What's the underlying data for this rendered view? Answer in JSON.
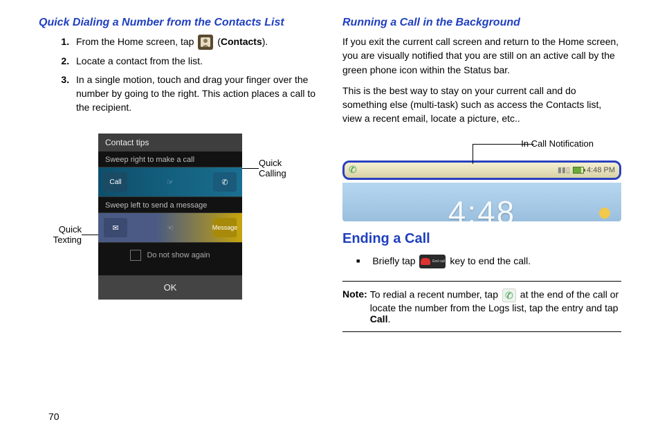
{
  "page_number": "70",
  "left": {
    "heading": "Quick Dialing a Number from the Contacts List",
    "steps": {
      "s1_a": "From the Home screen, tap ",
      "s1_b": " (",
      "s1_bold": "Contacts",
      "s1_c": ").",
      "s2": "Locate a contact from the list.",
      "s3": "In a single motion, touch and drag your finger over the number by going to the right. This action places a call to the recipient."
    },
    "fig": {
      "title": "Contact tips",
      "hint_call": "Sweep right to make a call",
      "row_call_left": "Call",
      "hint_msg": "Sweep left to send a message",
      "row_msg_right": "Message",
      "dns": "Do not show again",
      "ok": "OK",
      "label_left_a": "Quick",
      "label_left_b": "Texting",
      "label_right_a": "Quick",
      "label_right_b": "Calling"
    }
  },
  "right": {
    "heading1": "Running a Call in the Background",
    "p1": "If you exit the current call screen and return to the Home screen, you are visually notified that you are still on an active call by the green phone icon within the Status bar.",
    "p2": "This is the best way to stay on your current call and do something else (multi-task) such as access the Contacts list, view a recent email, locate a picture, etc..",
    "fig_label": "In Call Notification",
    "status_time": "4:48 PM",
    "clock_peek": "4:48",
    "heading2": "Ending a Call",
    "bullet_a": "Briefly tap ",
    "bullet_b": " key to end the call.",
    "endcall_text": "End call",
    "note_label": "Note:",
    "note_a": "To redial a recent number, tap ",
    "note_b": " at the end of the call or locate the number from the Logs list, tap the entry and tap ",
    "note_bold": "Call",
    "note_c": "."
  }
}
